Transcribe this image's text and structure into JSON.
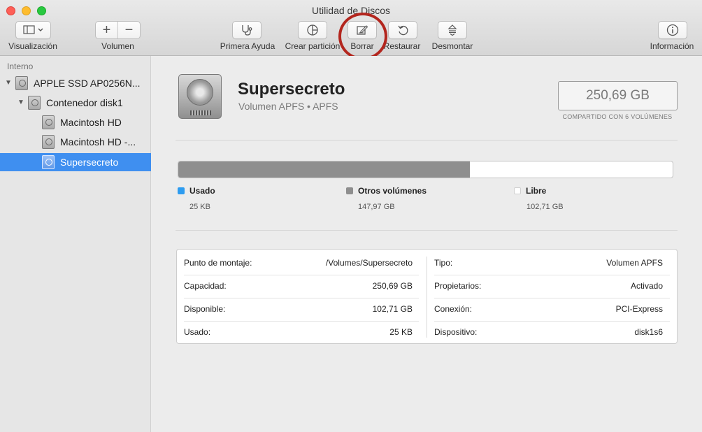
{
  "window": {
    "title": "Utilidad de Discos"
  },
  "toolbar": {
    "view_label": "Visualización",
    "volume_label": "Volumen",
    "volume_add": "+",
    "volume_remove": "−",
    "first_aid": "Primera Ayuda",
    "partition": "Crear partición",
    "erase": "Borrar",
    "restore": "Restaurar",
    "unmount": "Desmontar",
    "info": "Información"
  },
  "sidebar": {
    "section": "Interno",
    "items": [
      {
        "label": "APPLE SSD AP0256N...",
        "level": 0,
        "expanded": true
      },
      {
        "label": "Contenedor disk1",
        "level": 1,
        "expanded": true
      },
      {
        "label": "Macintosh HD",
        "level": 2
      },
      {
        "label": "Macintosh HD -...",
        "level": 2
      },
      {
        "label": "Supersecreto",
        "level": 2,
        "selected": true
      }
    ]
  },
  "volume": {
    "name": "Supersecreto",
    "subtitle": "Volumen APFS • APFS",
    "capacity": "250,69 GB",
    "shared_note": "COMPARTIDO CON 6 VOLÚMENES"
  },
  "usage": {
    "other_fraction": 0.59,
    "legend": [
      {
        "label": "Usado",
        "value": "25 KB",
        "color": "#2d9cf0"
      },
      {
        "label": "Otros volúmenes",
        "value": "147,97 GB",
        "color": "#8e8e8e"
      },
      {
        "label": "Libre",
        "value": "102,71 GB",
        "color": "#ffffff"
      }
    ]
  },
  "info": {
    "left": [
      {
        "key": "Punto de montaje:",
        "value": "/Volumes/Supersecreto"
      },
      {
        "key": "Capacidad:",
        "value": "250,69 GB"
      },
      {
        "key": "Disponible:",
        "value": "102,71 GB"
      },
      {
        "key": "Usado:",
        "value": "25 KB"
      }
    ],
    "right": [
      {
        "key": "Tipo:",
        "value": "Volumen APFS"
      },
      {
        "key": "Propietarios:",
        "value": "Activado"
      },
      {
        "key": "Conexión:",
        "value": "PCI-Express"
      },
      {
        "key": "Dispositivo:",
        "value": "disk1s6"
      }
    ]
  }
}
